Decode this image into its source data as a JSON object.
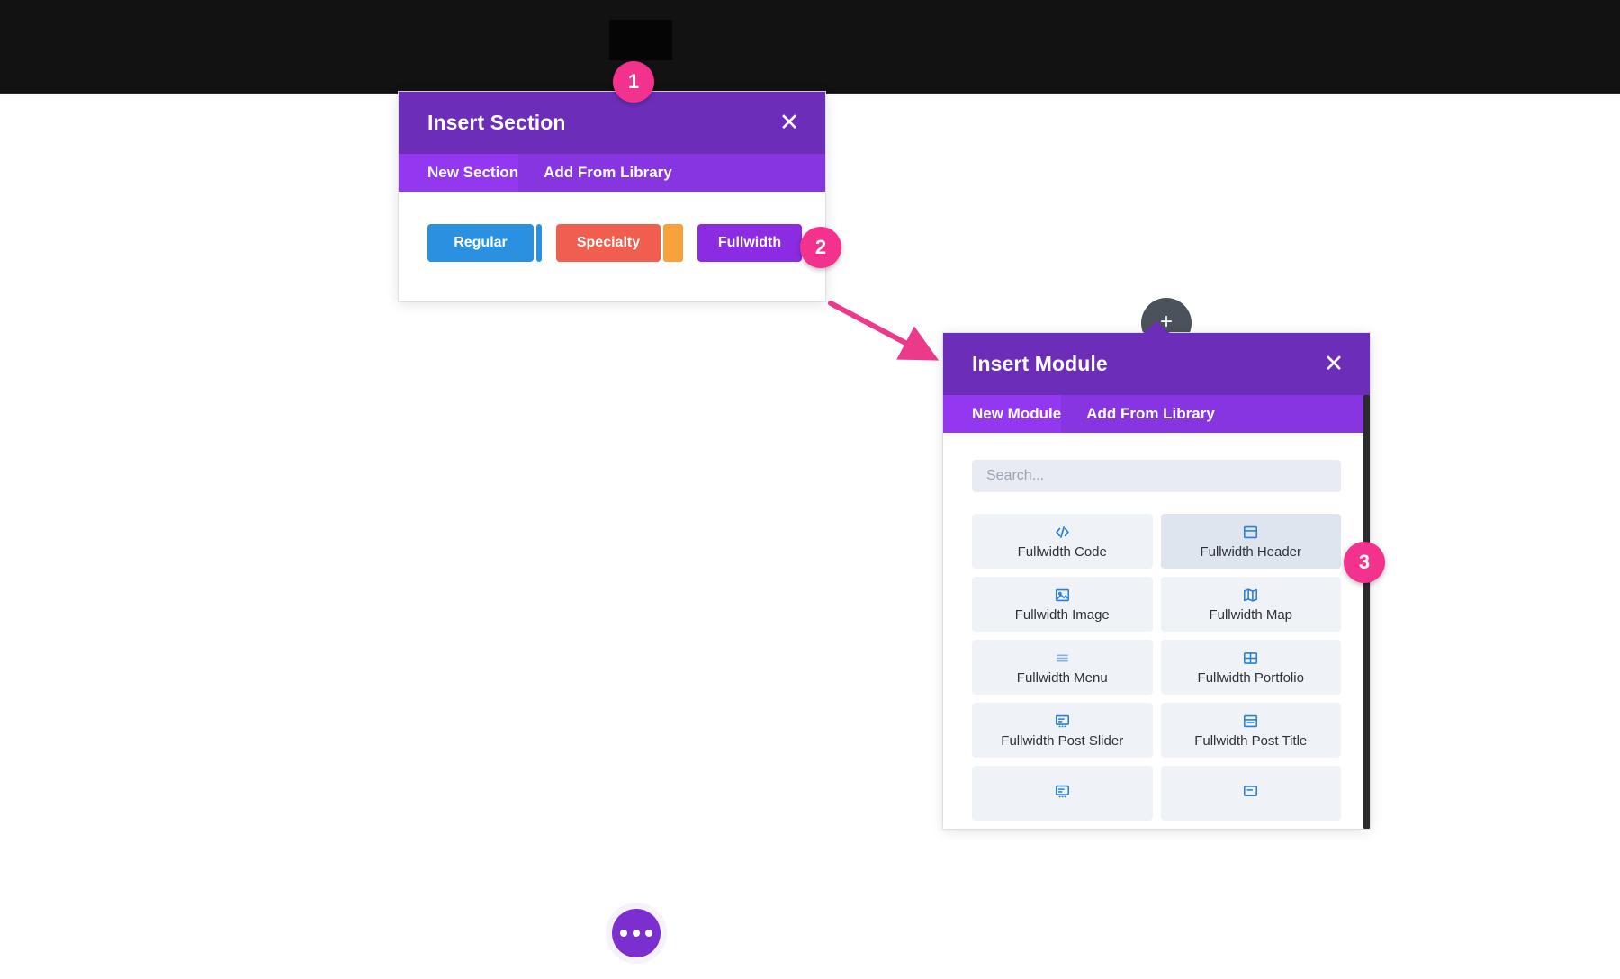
{
  "insert_section": {
    "title": "Insert Section",
    "close_icon": "close-icon",
    "tabs": [
      {
        "label": "New Section",
        "active": true
      },
      {
        "label": "Add From Library",
        "active": false
      }
    ],
    "buttons": [
      {
        "label": "Regular",
        "color": "#2b90e0"
      },
      {
        "label": "Specialty",
        "color": "#ef5e4e"
      },
      {
        "label": "Fullwidth",
        "color": "#8b2be2"
      }
    ],
    "accent_strips": [
      {
        "name": "regular-accent-strip",
        "color": "#2b90e0"
      },
      {
        "name": "specialty-accent-strip",
        "color": "#f9a13a"
      }
    ]
  },
  "insert_module": {
    "title": "Insert Module",
    "close_icon": "close-icon",
    "tabs": [
      {
        "label": "New Module",
        "active": true
      },
      {
        "label": "Add From Library",
        "active": false
      }
    ],
    "search": {
      "placeholder": "Search...",
      "value": ""
    },
    "modules": [
      {
        "label": "Fullwidth Code",
        "icon": "code-icon",
        "hovered": false
      },
      {
        "label": "Fullwidth Header",
        "icon": "header-icon",
        "hovered": true
      },
      {
        "label": "Fullwidth Image",
        "icon": "image-icon",
        "hovered": false
      },
      {
        "label": "Fullwidth Map",
        "icon": "map-icon",
        "hovered": false
      },
      {
        "label": "Fullwidth Menu",
        "icon": "menu-icon",
        "hovered": false
      },
      {
        "label": "Fullwidth Portfolio",
        "icon": "portfolio-icon",
        "hovered": false
      },
      {
        "label": "Fullwidth Post Slider",
        "icon": "post-slider-icon",
        "hovered": false
      },
      {
        "label": "Fullwidth Post Title",
        "icon": "post-title-icon",
        "hovered": false
      },
      {
        "label": "",
        "icon": "post-slider-icon",
        "hovered": false
      },
      {
        "label": "",
        "icon": "slider-icon",
        "hovered": false
      }
    ],
    "scrollbar": {
      "name": "vertical-scrollbar"
    }
  },
  "canvas": {
    "add_button_icon": "plus-icon",
    "more_options_icon": "ellipsis-icon"
  },
  "annotations": [
    {
      "number": "1",
      "target": "insert-section-modal"
    },
    {
      "number": "2",
      "target": "fullwidth-section-button"
    },
    {
      "number": "3",
      "target": "module-list-scrollbar"
    }
  ],
  "colors": {
    "purple_header": "#6c2eb9",
    "purple_tabs": "#8735e0",
    "purple_tab_active": "#9338f0",
    "badge_pink": "#f2328c",
    "arrow_pink": "#ec3a8b",
    "module_card": "#eff3f8",
    "module_card_hover": "#dfe5ee",
    "icon_blue": "#2b7fd4"
  }
}
